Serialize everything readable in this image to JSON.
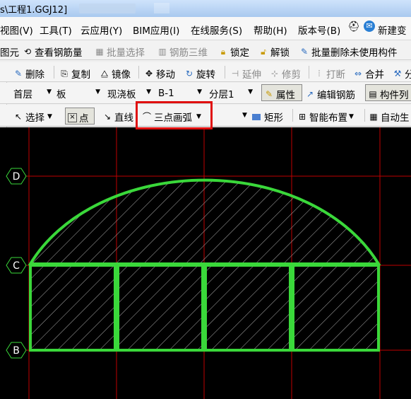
{
  "window": {
    "title": "s\\工程1.GGJ12]"
  },
  "menu": [
    "视图(V)",
    "工具(T)",
    "云应用(Y)",
    "BIM应用(I)",
    "在线服务(S)",
    "帮助(H)",
    "版本号(B)",
    "新建变"
  ],
  "toolbar1": {
    "items": [
      "图元",
      "查看钢筋量",
      "批量选择",
      "钢筋三维",
      "锁定",
      "解锁",
      "批量删除未使用构件"
    ]
  },
  "toolbar2": {
    "items": [
      "删除",
      "复制",
      "镜像",
      "移动",
      "旋转",
      "延伸",
      "修剪",
      "打断",
      "合并",
      "分"
    ]
  },
  "toolbar3": {
    "floor": "首层",
    "category": "板",
    "type": "现浇板",
    "component": "B-1",
    "layer": "分层1",
    "properties": "属性",
    "edit_rebar": "编辑钢筋",
    "component_list": "构件列"
  },
  "toolbar4": {
    "select": "选择",
    "point": "点",
    "line": "直线",
    "three_point_arc": "三点画弧",
    "rectangle": "矩形",
    "smart_layout": "智能布置",
    "auto_gen": "自动生"
  },
  "colors": {
    "canvas_bg": "#000000",
    "grid_line": "#c00000",
    "slab_outline": "#3ad83a",
    "hatch": "#b0b0b0",
    "highlight": "#e01010"
  },
  "drawing": {
    "axes": [
      "D",
      "C",
      "B"
    ]
  }
}
